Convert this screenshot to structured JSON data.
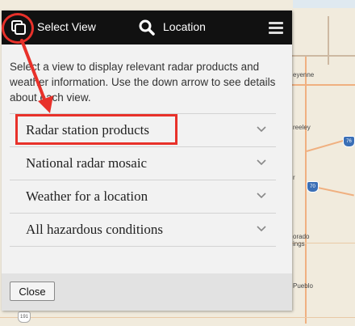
{
  "header": {
    "select_view_label": "Select View",
    "location_label": "Location",
    "icons": [
      "copy-views-icon",
      "search-icon",
      "hamburger-menu-icon"
    ]
  },
  "intro_text": "Select a view to display relevant radar products and weather information. Use the down arrow to see details about each view.",
  "views": [
    {
      "label": "Radar station products"
    },
    {
      "label": "National radar mosaic"
    },
    {
      "label": "Weather for a location"
    },
    {
      "label": "All hazardous conditions"
    }
  ],
  "footer": {
    "close_label": "Close"
  },
  "map_labels": {
    "cheyenne": "eyenne",
    "greeley": "reeley",
    "r": "r",
    "colorado_springs_1": "orado",
    "colorado_springs_2": "ings",
    "pueblo": "Pueblo",
    "shield_76": "76",
    "shield_70": "70",
    "shield_191": "191"
  },
  "colors": {
    "topbar": "#111111",
    "annotation": "#e8312a",
    "panel_bg": "#f2f2f2",
    "footer_bg": "#e2e2e2"
  }
}
